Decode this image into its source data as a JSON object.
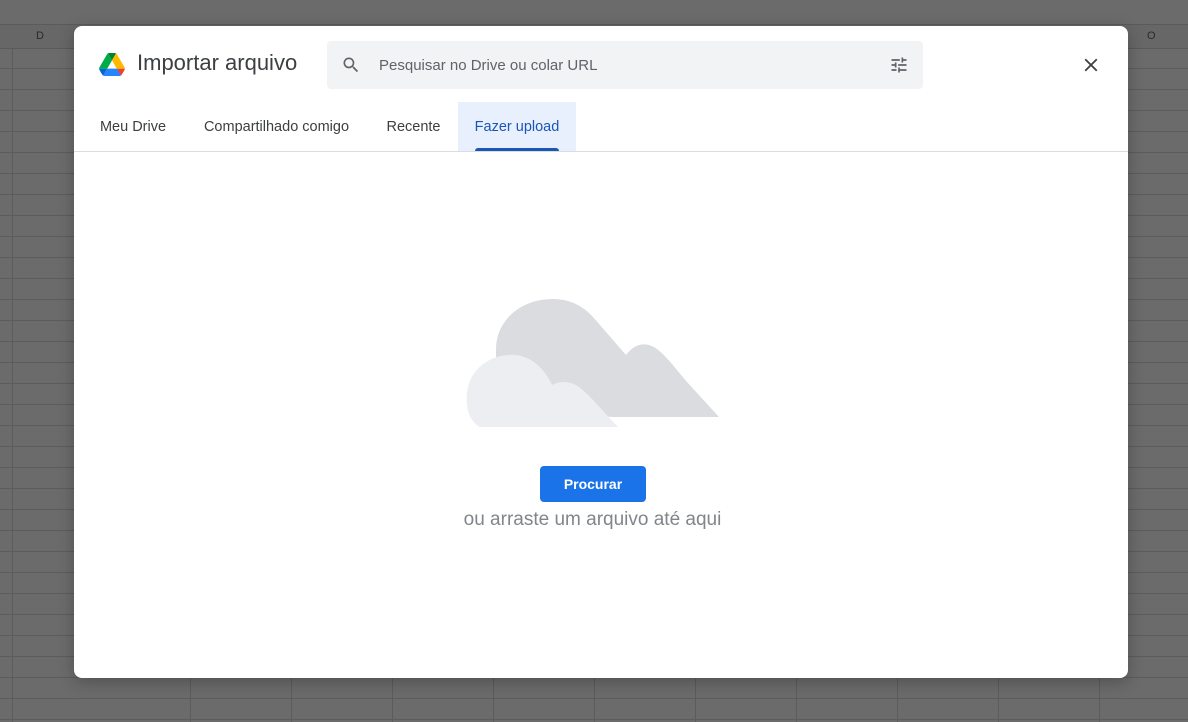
{
  "background": {
    "column_letters": [
      "D",
      "O"
    ]
  },
  "dialog": {
    "title": "Importar arquivo",
    "logo_icon": "google-drive-icon",
    "search": {
      "placeholder": "Pesquisar no Drive ou colar URL",
      "value": "",
      "left_icon": "search-icon",
      "right_icon": "tune-icon"
    },
    "close_icon": "close-icon",
    "tabs": [
      {
        "label": "Meu Drive",
        "active": false
      },
      {
        "label": "Compartilhado comigo",
        "active": false
      },
      {
        "label": "Recente",
        "active": false
      },
      {
        "label": "Fazer upload",
        "active": true
      }
    ],
    "upload": {
      "illustration": "clouds-icon",
      "browse_label": "Procurar",
      "hint": "ou arraste um arquivo até aqui"
    }
  },
  "colors": {
    "accent": "#1a73e8",
    "active_tab_text": "#1a56b6",
    "active_tab_bg": "#e8f0fe",
    "overlay": "#6b6b6b"
  }
}
